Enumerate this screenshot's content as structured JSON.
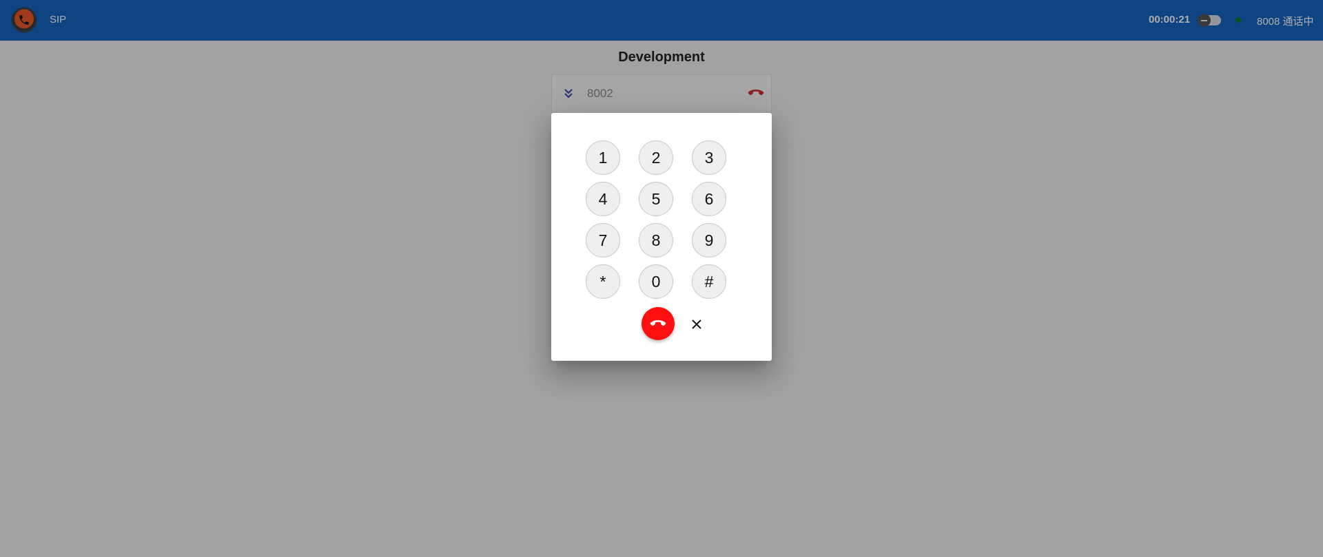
{
  "header": {
    "app_title": "SIP",
    "call_timer": "00:00:21",
    "status_text": "8008 通话中",
    "brand_color": "#1565c0",
    "status_dot_color": "#0a7a2a"
  },
  "main": {
    "heading": "Development",
    "active_call": {
      "number": "8002",
      "expand_icon": "double-chevron-down-icon",
      "hangup_icon": "phone-hangup-icon",
      "hangup_color": "#d32f2f"
    }
  },
  "dialpad": {
    "keys": [
      "1",
      "2",
      "3",
      "4",
      "5",
      "6",
      "7",
      "8",
      "9",
      "*",
      "0",
      "#"
    ],
    "hangup_icon": "phone-hangup-icon",
    "hangup_color": "#ff1010",
    "close_icon": "close-icon"
  }
}
